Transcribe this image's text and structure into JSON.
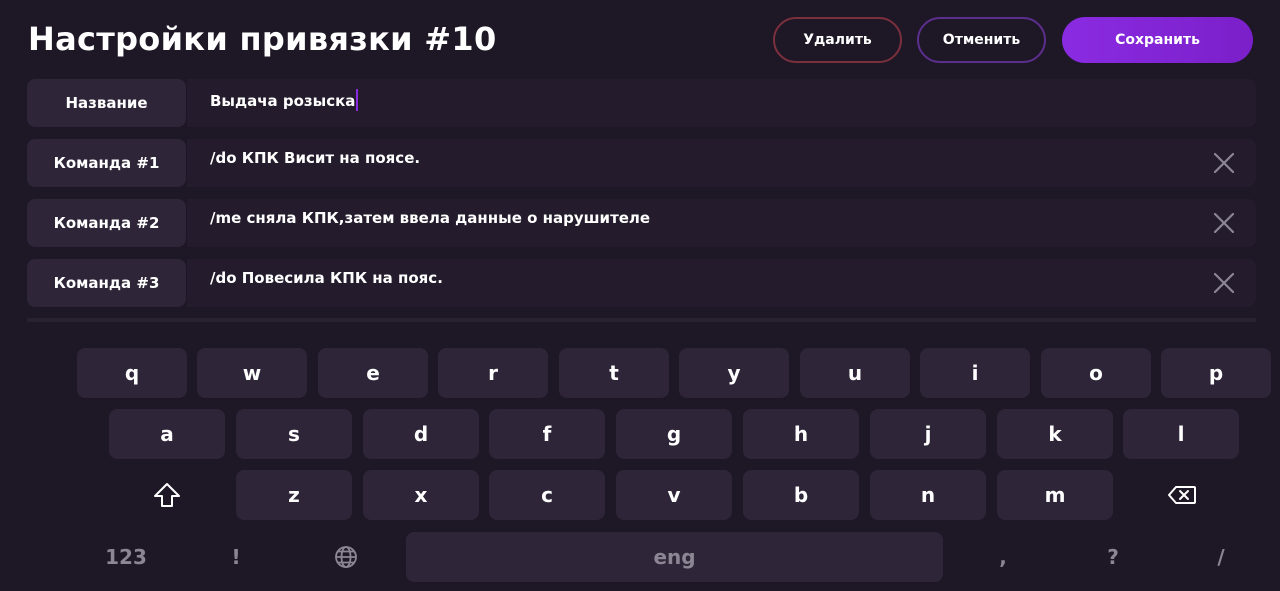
{
  "header": {
    "title": "Настройки привязки #10",
    "delete_label": "Удалить",
    "cancel_label": "Отменить",
    "save_label": "Сохранить"
  },
  "rows": [
    {
      "label": "Название",
      "value": "Выдача розыска"
    },
    {
      "label": "Команда #1",
      "value": "/do КПК Висит на поясе."
    },
    {
      "label": "Команда #2",
      "value": "/me сняла КПК,затем ввела данные о нарушителе"
    },
    {
      "label": "Команда #3",
      "value": "/do Повесила КПК на пояс."
    }
  ],
  "keyboard": {
    "row1": [
      "q",
      "w",
      "e",
      "r",
      "t",
      "y",
      "u",
      "i",
      "o",
      "p"
    ],
    "row2": [
      "a",
      "s",
      "d",
      "f",
      "g",
      "h",
      "j",
      "k",
      "l"
    ],
    "row3": [
      "z",
      "x",
      "c",
      "v",
      "b",
      "n",
      "m"
    ],
    "numbers_label": "123",
    "exclaim_label": "!",
    "space_label": "eng",
    "comma_label": ",",
    "question_label": "?",
    "slash_label": "/",
    "shift_icon": "shift-icon",
    "backspace_icon": "backspace-icon",
    "globe_icon": "globe-icon"
  },
  "colors": {
    "background": "#1e1726",
    "accent": "#8a2be2",
    "delete_border": "#7a2f3d",
    "cancel_border": "#5b2e8c"
  }
}
